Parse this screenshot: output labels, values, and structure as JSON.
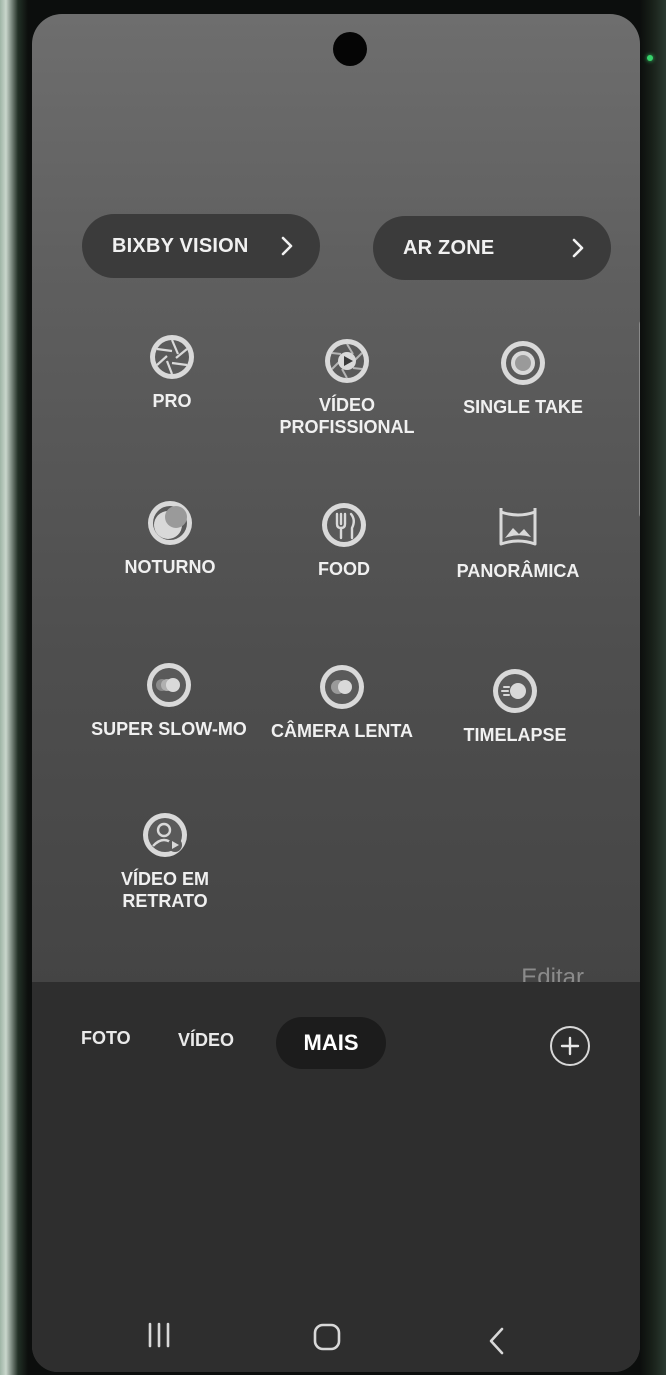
{
  "quick_links": [
    {
      "label": "BIXBY VISION"
    },
    {
      "label": "AR ZONE"
    }
  ],
  "modes": [
    {
      "label": "PRO",
      "icon": "pro-aperture-icon"
    },
    {
      "label": "VÍDEO PROFISSIONAL",
      "line1": "VÍDEO",
      "line2": "PROFISSIONAL",
      "icon": "pro-video-icon"
    },
    {
      "label": "SINGLE TAKE",
      "icon": "single-take-icon"
    },
    {
      "label": "NOTURNO",
      "icon": "night-moon-icon"
    },
    {
      "label": "FOOD",
      "icon": "food-fork-icon"
    },
    {
      "label": "PANORÂMICA",
      "icon": "panorama-icon"
    },
    {
      "label": "SUPER SLOW-MO",
      "icon": "super-slow-mo-icon"
    },
    {
      "label": "CÂMERA LENTA",
      "icon": "slow-motion-icon"
    },
    {
      "label": "TIMELAPSE",
      "icon": "timelapse-icon"
    },
    {
      "label": "VÍDEO EM RETRATO",
      "line1": "VÍDEO EM",
      "line2": "RETRATO",
      "icon": "portrait-video-icon"
    }
  ],
  "edit_label": "Editar",
  "mode_tabs": {
    "photo": "FOTO",
    "video": "VÍDEO",
    "more": "MAIS"
  },
  "nav_icons": [
    "recent-apps-icon",
    "home-icon",
    "back-icon"
  ],
  "colors": {
    "screen_bg": "#5f5f5f",
    "panel_bg": "#2e2e2e",
    "pill_bg": "#3b3b3b",
    "text": "#f0f0f0",
    "led": "#37d36b"
  }
}
